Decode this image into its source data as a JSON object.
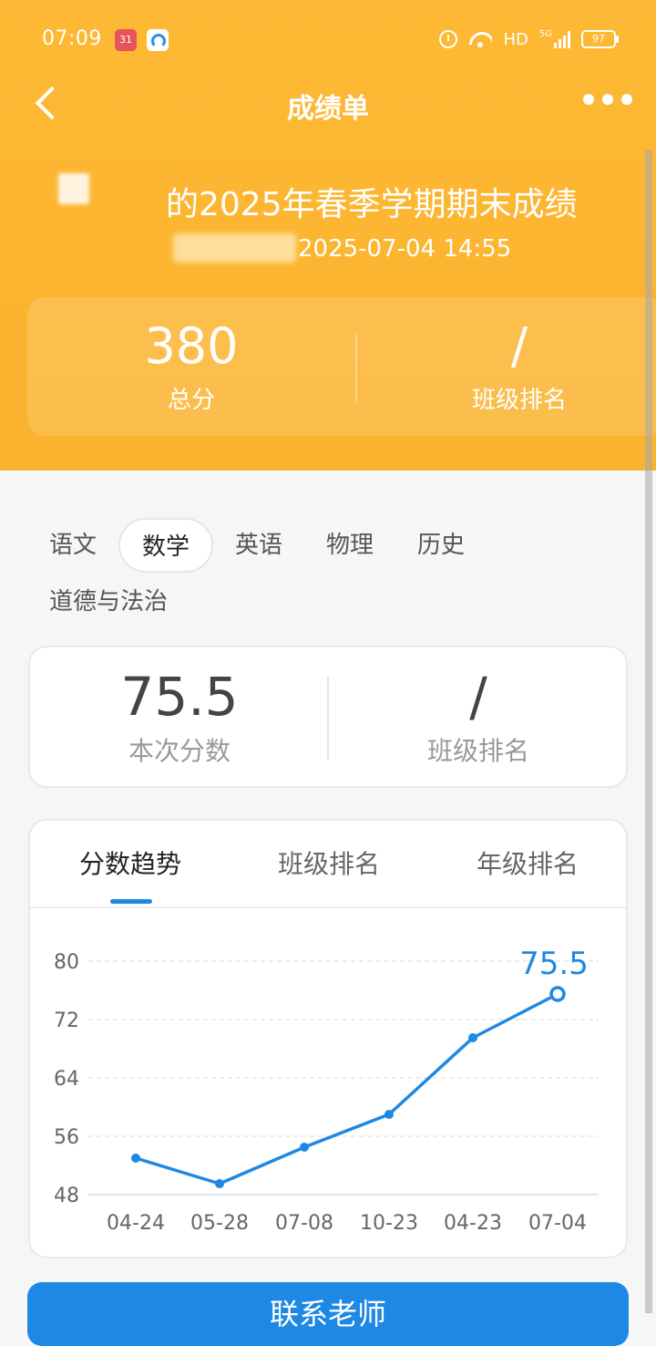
{
  "status_bar": {
    "time": "07:09",
    "calendar_badge": "31",
    "network": "HD",
    "network_gen": "5G",
    "battery": "97"
  },
  "nav": {
    "title": "成绩单"
  },
  "header": {
    "exam_title": "的2025年春季学期期末成绩",
    "published_at": "2025-07-04 14:55"
  },
  "summary": {
    "total_score": "380",
    "total_label": "总分",
    "class_rank": "/",
    "class_rank_label": "班级排名"
  },
  "subjects": [
    {
      "label": "语文"
    },
    {
      "label": "数学",
      "active": true
    },
    {
      "label": "英语"
    },
    {
      "label": "物理"
    },
    {
      "label": "历史"
    },
    {
      "label": "道德与法治"
    }
  ],
  "score_card": {
    "score": "75.5",
    "score_label": "本次分数",
    "rank": "/",
    "rank_label": "班级排名"
  },
  "trend": {
    "tabs": [
      {
        "label": "分数趋势",
        "active": true
      },
      {
        "label": "班级排名"
      },
      {
        "label": "年级排名"
      }
    ]
  },
  "chart_data": {
    "type": "line",
    "categories": [
      "04-24",
      "05-28",
      "07-08",
      "10-23",
      "04-23",
      "07-04"
    ],
    "values": [
      53,
      49.5,
      54.5,
      59,
      69.5,
      75.5
    ],
    "ylim": [
      48,
      80
    ],
    "yticks": [
      48,
      56,
      64,
      72,
      80
    ],
    "highlight_label": "75.5",
    "color": "#1e88e5",
    "grid": true
  },
  "footer": {
    "contact_label": "联系老师"
  },
  "colors": {
    "header": "#fdb935",
    "accent": "#1e88e5"
  }
}
